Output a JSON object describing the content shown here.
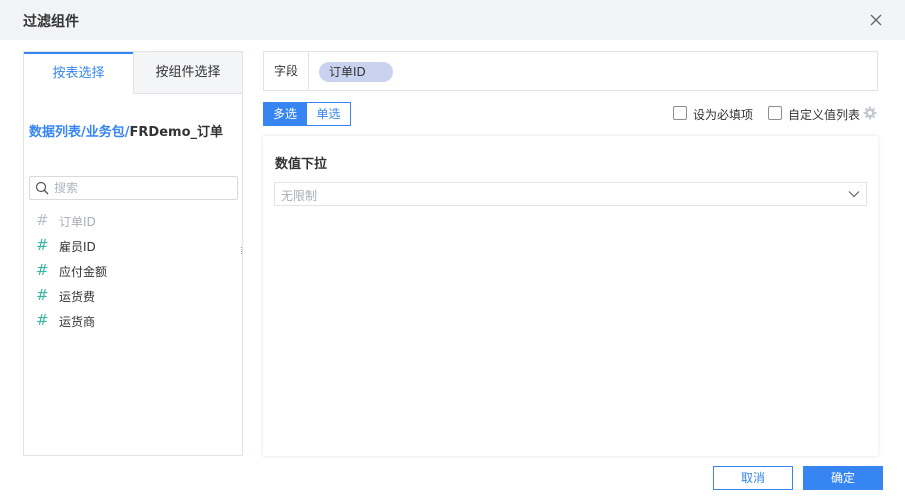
{
  "dialog": {
    "title": "过滤组件"
  },
  "left_panel": {
    "tabs": [
      {
        "label": "按表选择",
        "active": true
      },
      {
        "label": "按组件选择",
        "active": false
      }
    ],
    "breadcrumb": {
      "link1": "数据列表",
      "sep1": "/",
      "link2": "业务包",
      "sep2": "/",
      "current": "FRDemo_订单"
    },
    "search": {
      "placeholder": "搜索",
      "value": ""
    },
    "fields": [
      {
        "hash": "#",
        "name": "订单ID",
        "disabled": true
      },
      {
        "hash": "#",
        "name": "雇员ID",
        "disabled": false
      },
      {
        "hash": "#",
        "name": "应付金额",
        "disabled": false
      },
      {
        "hash": "#",
        "name": "运货费",
        "disabled": false
      },
      {
        "hash": "#",
        "name": "运货商",
        "disabled": false
      }
    ]
  },
  "right_panel": {
    "field_label": "字段",
    "field_chip": "订单ID",
    "mode": {
      "multi": "多选",
      "single": "单选",
      "selected": "多选"
    },
    "required_label": "设为必填项",
    "required_checked": false,
    "custom_list_label": "自定义值列表",
    "custom_list_checked": false,
    "card_title": "数值下拉",
    "select_value": "无限制"
  },
  "footer": {
    "cancel": "取消",
    "confirm": "确定"
  },
  "colors": {
    "accent": "#3685f2",
    "hash": "#3ab5a6",
    "chip": "#c9d3f0"
  },
  "icons": [
    "close-icon",
    "search-icon",
    "gear-icon",
    "chevron-down-icon"
  ]
}
